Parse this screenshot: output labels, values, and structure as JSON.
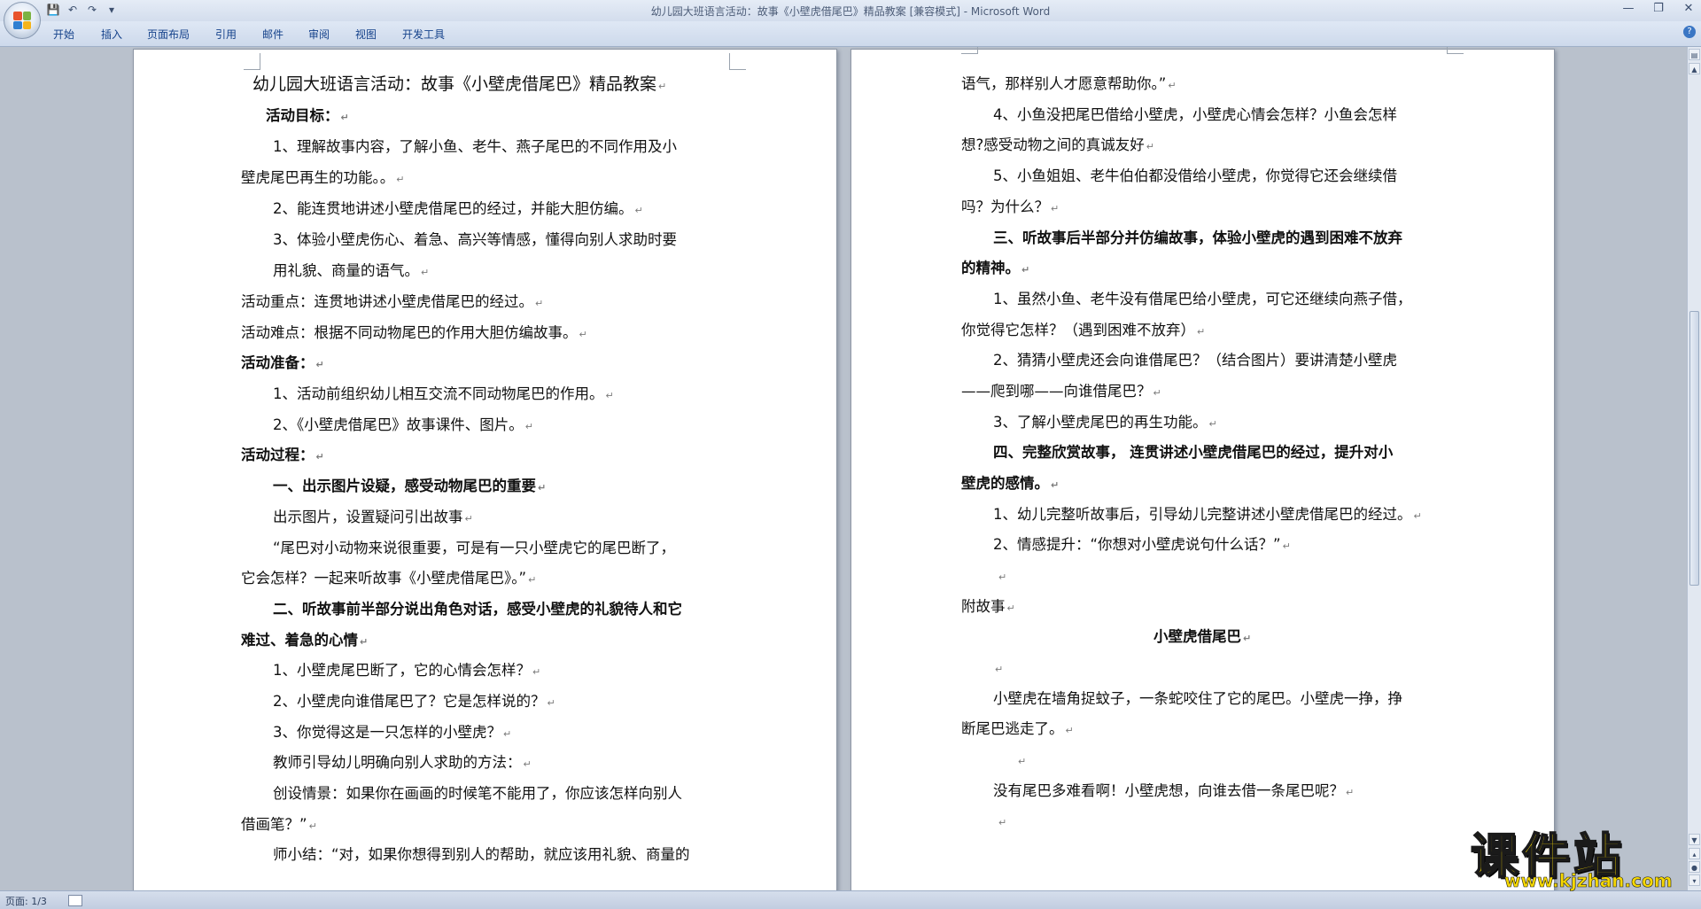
{
  "window": {
    "title": "幼儿园大班语言活动：故事《小壁虎借尾巴》精品教案 [兼容模式] - Microsoft Word"
  },
  "qat": {
    "save": "💾",
    "undo": "↶",
    "redo": "↷",
    "customize": "▾"
  },
  "window_controls": {
    "minimize": "—",
    "restore": "❐",
    "close": "✕"
  },
  "ribbon": {
    "tabs": [
      "开始",
      "插入",
      "页面布局",
      "引用",
      "邮件",
      "审阅",
      "视图",
      "开发工具"
    ],
    "help": "?"
  },
  "page_left": {
    "title": "幼儿园大班语言活动：故事《小壁虎借尾巴》精品教案",
    "lines": [
      "活动目标：",
      "1、理解故事内容，了解小鱼、老牛、燕子尾巴的不同作用及小",
      "壁虎尾巴再生的功能。。",
      "2、能连贯地讲述小壁虎借尾巴的经过，并能大胆仿编。",
      "3、体验小壁虎伤心、着急、高兴等情感，懂得向别人求助时要",
      "用礼貌、商量的语气。",
      "活动重点：连贯地讲述小壁虎借尾巴的经过。",
      "活动难点：根据不同动物尾巴的作用大胆仿编故事。",
      "活动准备：",
      "1、活动前组织幼儿相互交流不同动物尾巴的作用。",
      "2、《小壁虎借尾巴》故事课件、图片。",
      "活动过程：",
      "一、出示图片设疑，感受动物尾巴的重要",
      "出示图片，设置疑问引出故事",
      "“尾巴对小动物来说很重要，可是有一只小壁虎它的尾巴断了，",
      "它会怎样？一起来听故事《小壁虎借尾巴》。”",
      "二、听故事前半部分说出角色对话，感受小壁虎的礼貌待人和它",
      "难过、着急的心情",
      "1、小壁虎尾巴断了，它的心情会怎样？",
      "2、小壁虎向谁借尾巴了？它是怎样说的？",
      "3、你觉得这是一只怎样的小壁虎？",
      "教师引导幼儿明确向别人求助的方法：",
      "创设情景：如果你在画画的时候笔不能用了，你应该怎样向别人",
      "借画笔？”",
      "师小结：“对，如果你想得到别人的帮助，就应该用礼貌、商量的"
    ]
  },
  "page_right": {
    "lines": [
      "语气，那样别人才愿意帮助你。”",
      "4、小鱼没把尾巴借给小壁虎，小壁虎心情会怎样？小鱼会怎样",
      "想?感受动物之间的真诚友好",
      "5、小鱼姐姐、老牛伯伯都没借给小壁虎，你觉得它还会继续借",
      "吗？为什么？",
      "三、听故事后半部分并仿编故事，体验小壁虎的遇到困难不放弃",
      "的精神。",
      "1、虽然小鱼、老牛没有借尾巴给小壁虎，可它还继续向燕子借，",
      "你觉得它怎样？（遇到困难不放弃）",
      "2、猜猜小壁虎还会向谁借尾巴？（结合图片）要讲清楚小壁虎",
      "——爬到哪——向谁借尾巴？",
      "3、了解小壁虎尾巴的再生功能。",
      "四、完整欣赏故事， 连贯讲述小壁虎借尾巴的经过，提升对小",
      "壁虎的感情。",
      "1、幼儿完整听故事后，引导幼儿完整讲述小壁虎借尾巴的经过。",
      "2、情感提升：“你想对小壁虎说句什么话？”",
      "附故事",
      "小壁虎借尾巴",
      "小壁虎在墙角捉蚊子，一条蛇咬住了它的尾巴。小壁虎一挣，挣",
      "断尾巴逃走了。",
      "没有尾巴多难看啊！小壁虎想，向谁去借一条尾巴呢？"
    ]
  },
  "status_bar": {
    "page": "页面: 1/3"
  },
  "watermark": {
    "text": "课件站",
    "url": "www.kjzhan.com"
  },
  "colors": {
    "workspace": "#b9c1cc",
    "ribbon": "#dfe8f5",
    "tab_text": "#15428b",
    "watermark": "#f6d800"
  }
}
